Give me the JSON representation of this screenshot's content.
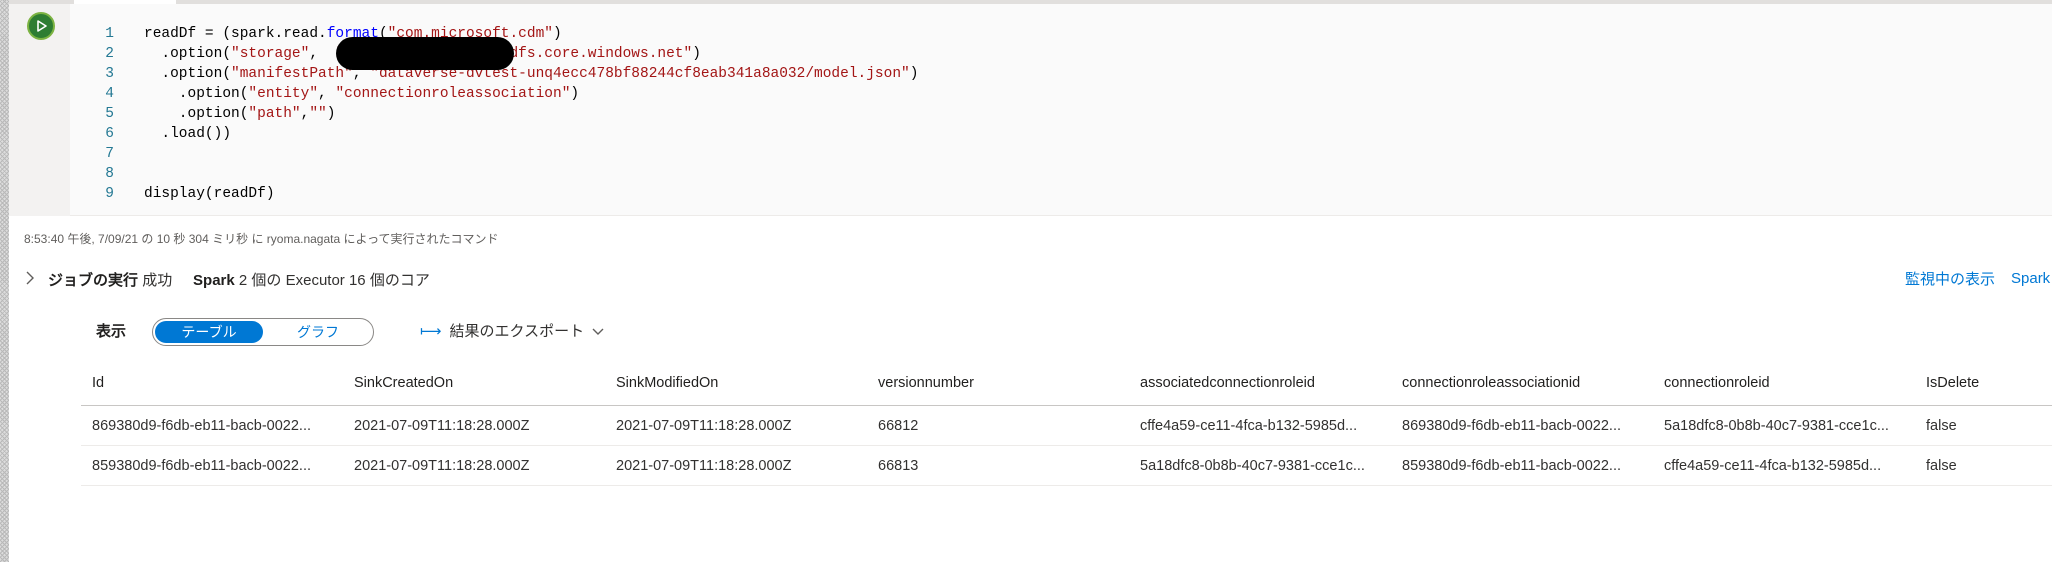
{
  "code": {
    "lines": [
      {
        "num": "1",
        "parts": [
          {
            "t": "readDf = (spark.read.",
            "c": ""
          },
          {
            "t": "format",
            "c": "fn"
          },
          {
            "t": "(",
            "c": ""
          },
          {
            "t": "\"com.microsoft.cdm\"",
            "c": "str"
          },
          {
            "t": ")",
            "c": ""
          }
        ]
      },
      {
        "num": "2",
        "parts": [
          {
            "t": "  .option(",
            "c": ""
          },
          {
            "t": "\"storage\"",
            "c": "str"
          },
          {
            "t": ",  ",
            "c": ""
          },
          {
            "t": "\"                   dfs.core.windows.net\"",
            "c": "str"
          },
          {
            "t": ")",
            "c": ""
          }
        ]
      },
      {
        "num": "3",
        "parts": [
          {
            "t": "  .option(",
            "c": ""
          },
          {
            "t": "\"manifestPath\"",
            "c": "str"
          },
          {
            "t": ", ",
            "c": ""
          },
          {
            "t": "\"dataverse-dvtest-unq4ecc478bf88244cf8eab341a8a032/model.json\"",
            "c": "str"
          },
          {
            "t": ")",
            "c": ""
          }
        ]
      },
      {
        "num": "4",
        "parts": [
          {
            "t": "    .option(",
            "c": ""
          },
          {
            "t": "\"entity\"",
            "c": "str"
          },
          {
            "t": ", ",
            "c": ""
          },
          {
            "t": "\"connectionroleassociation\"",
            "c": "str"
          },
          {
            "t": ")",
            "c": ""
          }
        ]
      },
      {
        "num": "5",
        "parts": [
          {
            "t": "    .option(",
            "c": ""
          },
          {
            "t": "\"path\"",
            "c": "str"
          },
          {
            "t": ",",
            "c": ""
          },
          {
            "t": "\"\"",
            "c": "str"
          },
          {
            "t": ")",
            "c": ""
          }
        ]
      },
      {
        "num": "6",
        "parts": [
          {
            "t": "  .load())",
            "c": ""
          }
        ]
      },
      {
        "num": "7",
        "parts": []
      },
      {
        "num": "8",
        "parts": []
      },
      {
        "num": "9",
        "parts": [
          {
            "t": "display(readDf)",
            "c": ""
          }
        ]
      }
    ]
  },
  "command_info": "8:53:40 午後, 7/09/21 の 10 秒 304 ミリ秒 に ryoma.nagata によって実行されたコマンド",
  "job": {
    "label": "ジョブの実行",
    "status": "成功",
    "spark_label": "Spark",
    "executors": "2 個の Executor 16 個のコア"
  },
  "links": {
    "monitor": "監視中の表示",
    "spark": "Spark"
  },
  "view": {
    "label": "表示",
    "table_tab": "テーブル",
    "chart_tab": "グラフ",
    "export_label": "結果のエクスポート"
  },
  "table": {
    "columns": [
      "Id",
      "SinkCreatedOn",
      "SinkModifiedOn",
      "versionnumber",
      "associatedconnectionroleid",
      "connectionroleassociationid",
      "connectionroleid",
      "IsDelete"
    ],
    "rows": [
      [
        "869380d9-f6db-eb11-bacb-0022...",
        "2021-07-09T11:18:28.000Z",
        "2021-07-09T11:18:28.000Z",
        "66812",
        "cffe4a59-ce11-4fca-b132-5985d...",
        "869380d9-f6db-eb11-bacb-0022...",
        "5a18dfc8-0b8b-40c7-9381-cce1c...",
        "false"
      ],
      [
        "859380d9-f6db-eb11-bacb-0022...",
        "2021-07-09T11:18:28.000Z",
        "2021-07-09T11:18:28.000Z",
        "66813",
        "5a18dfc8-0b8b-40c7-9381-cce1c...",
        "859380d9-f6db-eb11-bacb-0022...",
        "cffe4a59-ce11-4fca-b132-5985d...",
        "false"
      ]
    ]
  }
}
